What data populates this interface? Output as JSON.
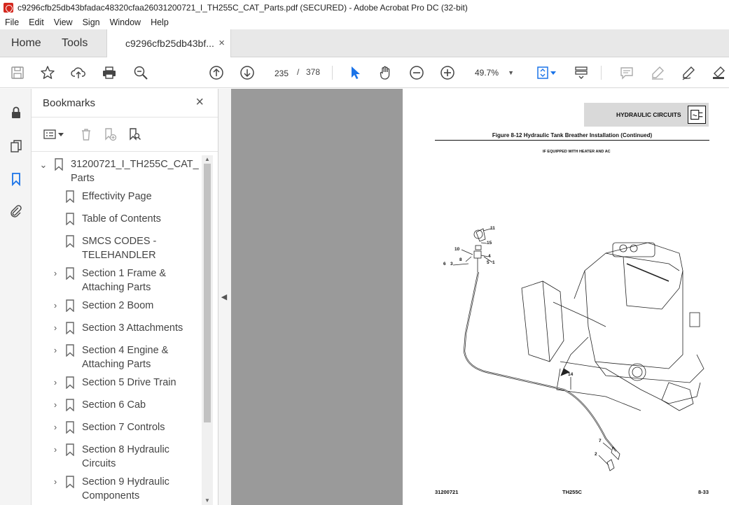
{
  "window": {
    "title": "c9296cfb25db43bfadac48320cfaa26031200721_I_TH255C_CAT_Parts.pdf (SECURED) - Adobe Acrobat Pro DC (32-bit)"
  },
  "menu": [
    "File",
    "Edit",
    "View",
    "Sign",
    "Window",
    "Help"
  ],
  "tabs": {
    "home": "Home",
    "tools": "Tools",
    "document": "c9296cfb25db43bf...",
    "close": "×"
  },
  "toolbar": {
    "current_page": "235",
    "page_separator": "/",
    "total_pages": "378",
    "zoom": "49.7%"
  },
  "bookmarks": {
    "header": "Bookmarks",
    "close": "×",
    "items": [
      {
        "label": "31200721_I_TH255C_CAT_Parts",
        "expanded": true
      },
      {
        "label": "Effectivity Page"
      },
      {
        "label": "Table of Contents"
      },
      {
        "label": "SMCS CODES - TELEHANDLER"
      },
      {
        "label": "Section 1 Frame & Attaching Parts",
        "expandable": true
      },
      {
        "label": "Section 2 Boom",
        "expandable": true
      },
      {
        "label": "Section 3 Attachments",
        "expandable": true
      },
      {
        "label": "Section 4 Engine & Attaching Parts",
        "expandable": true
      },
      {
        "label": "Section 5 Drive Train",
        "expandable": true
      },
      {
        "label": "Section 6 Cab",
        "expandable": true
      },
      {
        "label": "Section 7 Controls",
        "expandable": true
      },
      {
        "label": "Section 8 Hydraulic Circuits",
        "expandable": true
      },
      {
        "label": "Section 9 Hydraulic Components",
        "expandable": true
      }
    ]
  },
  "pdf_page": {
    "section_header": "HYDRAULIC CIRCUITS",
    "figure_title": "Figure 8-12 Hydraulic Tank Breather Installation (Continued)",
    "note": "IF EQUIPPED WITH HEATER AND AC",
    "callouts": [
      "11",
      "15",
      "10",
      "8",
      "6",
      "3",
      "4",
      "5",
      "1",
      "14",
      "7",
      "2"
    ],
    "footer_left": "31200721",
    "footer_center": "TH255C",
    "footer_right": "8-33"
  },
  "colors": {
    "accent": "#1a73e8",
    "acrobat_red": "#d4281e",
    "doc_background": "#9a9a9a"
  }
}
